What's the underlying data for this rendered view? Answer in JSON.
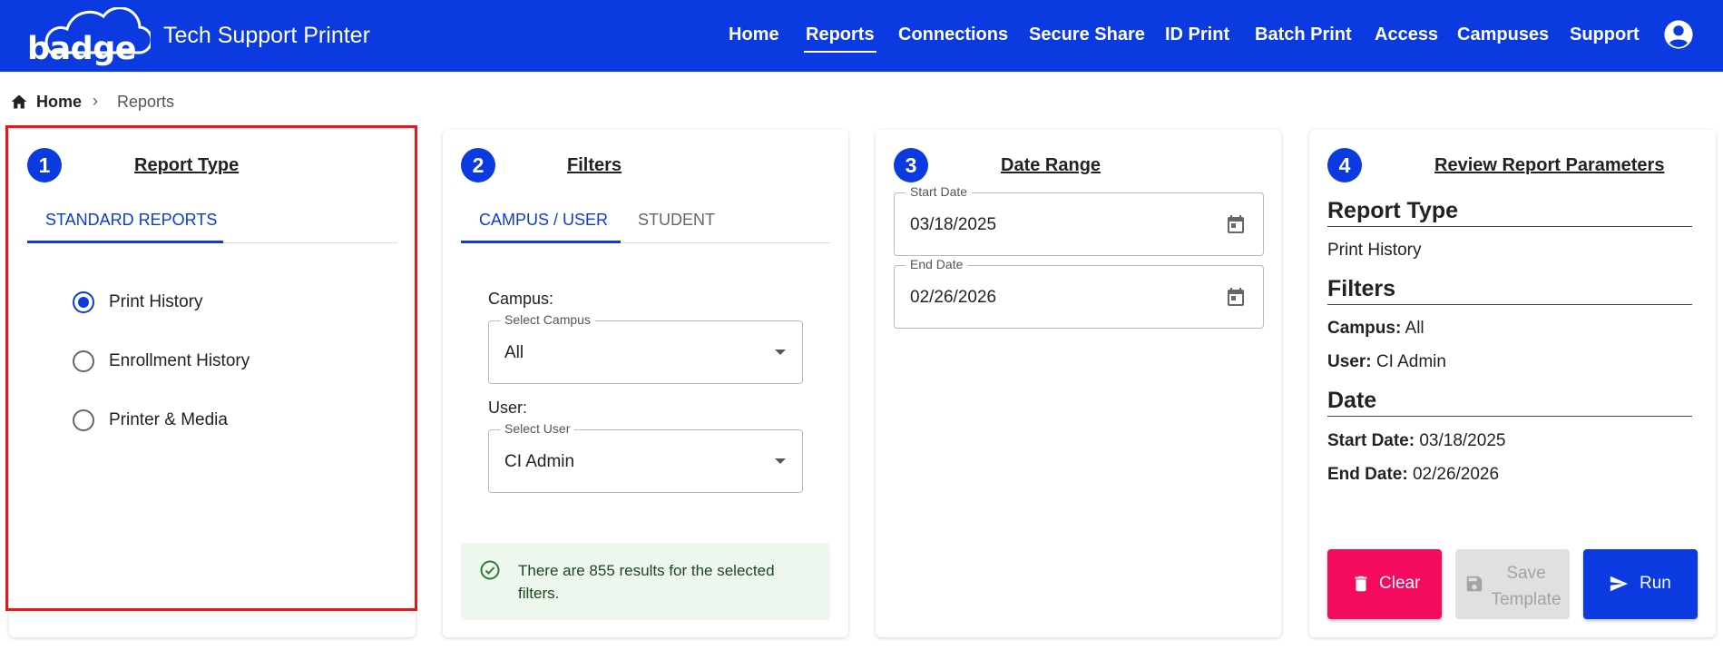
{
  "header": {
    "logo_text": "badge",
    "app_title": "Tech Support Printer",
    "nav": [
      {
        "label": "Home",
        "active": false
      },
      {
        "label": "Reports",
        "active": true
      },
      {
        "label": "Connections",
        "active": false
      },
      {
        "label": "Secure Share",
        "active": false
      },
      {
        "label": "ID Print",
        "active": false
      },
      {
        "label": "Batch Print",
        "active": false
      },
      {
        "label": "Access",
        "active": false
      },
      {
        "label": "Campuses",
        "active": false
      },
      {
        "label": "Support",
        "active": false
      }
    ],
    "user_icon": "account-circle-icon",
    "color": "#0b3be0"
  },
  "breadcrumb": {
    "home": "Home",
    "separator": "›",
    "current": "Reports"
  },
  "cards": {
    "report_type": {
      "step": "1",
      "title": "Report Type",
      "tabs": [
        "STANDARD REPORTS"
      ],
      "options": [
        {
          "label": "Print History",
          "checked": true
        },
        {
          "label": "Enrollment History",
          "checked": false
        },
        {
          "label": "Printer & Media",
          "checked": false
        }
      ]
    },
    "filters": {
      "step": "2",
      "title": "Filters",
      "tabs": [
        "CAMPUS / USER",
        "STUDENT"
      ],
      "campus_label": "Campus:",
      "campus_legend": "Select Campus",
      "campus_value": "All",
      "user_label": "User:",
      "user_legend": "Select User",
      "user_value": "CI Admin",
      "alert": "There are 855 results for the selected filters."
    },
    "date_range": {
      "step": "3",
      "title": "Date Range",
      "start_legend": "Start Date",
      "start_value": "03/18/2025",
      "end_legend": "End Date",
      "end_value": "02/26/2026"
    },
    "review": {
      "step": "4",
      "title": "Review Report Parameters",
      "report_type_heading": "Report Type",
      "report_type_value": "Print History",
      "filters_heading": "Filters",
      "campus_key": "Campus:",
      "campus_value": "All",
      "user_key": "User:",
      "user_value": "CI Admin",
      "date_heading": "Date",
      "start_key": "Start Date:",
      "start_value": "03/18/2025",
      "end_key": "End Date:",
      "end_value": "02/26/2026",
      "buttons": {
        "clear": "Clear",
        "save": "Save Template",
        "run": "Run"
      }
    }
  },
  "colors": {
    "primary": "#0b3be0",
    "clear_button": "#f40a5f",
    "highlight": "#e01a1a",
    "success_bg": "#edf7ed"
  }
}
